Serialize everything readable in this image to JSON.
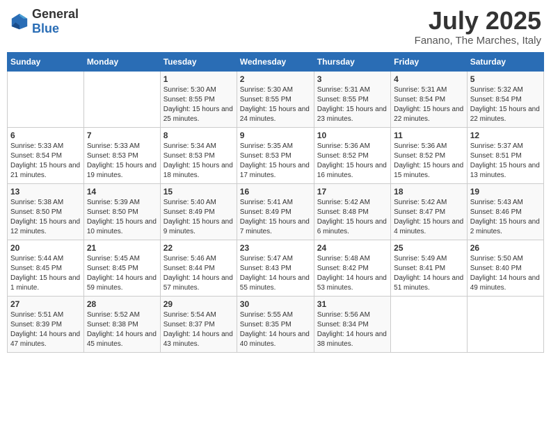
{
  "header": {
    "logo_general": "General",
    "logo_blue": "Blue",
    "month_title": "July 2025",
    "subtitle": "Fanano, The Marches, Italy"
  },
  "weekdays": [
    "Sunday",
    "Monday",
    "Tuesday",
    "Wednesday",
    "Thursday",
    "Friday",
    "Saturday"
  ],
  "weeks": [
    [
      {
        "day": "",
        "info": ""
      },
      {
        "day": "",
        "info": ""
      },
      {
        "day": "1",
        "info": "Sunrise: 5:30 AM\nSunset: 8:55 PM\nDaylight: 15 hours and 25 minutes."
      },
      {
        "day": "2",
        "info": "Sunrise: 5:30 AM\nSunset: 8:55 PM\nDaylight: 15 hours and 24 minutes."
      },
      {
        "day": "3",
        "info": "Sunrise: 5:31 AM\nSunset: 8:55 PM\nDaylight: 15 hours and 23 minutes."
      },
      {
        "day": "4",
        "info": "Sunrise: 5:31 AM\nSunset: 8:54 PM\nDaylight: 15 hours and 22 minutes."
      },
      {
        "day": "5",
        "info": "Sunrise: 5:32 AM\nSunset: 8:54 PM\nDaylight: 15 hours and 22 minutes."
      }
    ],
    [
      {
        "day": "6",
        "info": "Sunrise: 5:33 AM\nSunset: 8:54 PM\nDaylight: 15 hours and 21 minutes."
      },
      {
        "day": "7",
        "info": "Sunrise: 5:33 AM\nSunset: 8:53 PM\nDaylight: 15 hours and 19 minutes."
      },
      {
        "day": "8",
        "info": "Sunrise: 5:34 AM\nSunset: 8:53 PM\nDaylight: 15 hours and 18 minutes."
      },
      {
        "day": "9",
        "info": "Sunrise: 5:35 AM\nSunset: 8:53 PM\nDaylight: 15 hours and 17 minutes."
      },
      {
        "day": "10",
        "info": "Sunrise: 5:36 AM\nSunset: 8:52 PM\nDaylight: 15 hours and 16 minutes."
      },
      {
        "day": "11",
        "info": "Sunrise: 5:36 AM\nSunset: 8:52 PM\nDaylight: 15 hours and 15 minutes."
      },
      {
        "day": "12",
        "info": "Sunrise: 5:37 AM\nSunset: 8:51 PM\nDaylight: 15 hours and 13 minutes."
      }
    ],
    [
      {
        "day": "13",
        "info": "Sunrise: 5:38 AM\nSunset: 8:50 PM\nDaylight: 15 hours and 12 minutes."
      },
      {
        "day": "14",
        "info": "Sunrise: 5:39 AM\nSunset: 8:50 PM\nDaylight: 15 hours and 10 minutes."
      },
      {
        "day": "15",
        "info": "Sunrise: 5:40 AM\nSunset: 8:49 PM\nDaylight: 15 hours and 9 minutes."
      },
      {
        "day": "16",
        "info": "Sunrise: 5:41 AM\nSunset: 8:49 PM\nDaylight: 15 hours and 7 minutes."
      },
      {
        "day": "17",
        "info": "Sunrise: 5:42 AM\nSunset: 8:48 PM\nDaylight: 15 hours and 6 minutes."
      },
      {
        "day": "18",
        "info": "Sunrise: 5:42 AM\nSunset: 8:47 PM\nDaylight: 15 hours and 4 minutes."
      },
      {
        "day": "19",
        "info": "Sunrise: 5:43 AM\nSunset: 8:46 PM\nDaylight: 15 hours and 2 minutes."
      }
    ],
    [
      {
        "day": "20",
        "info": "Sunrise: 5:44 AM\nSunset: 8:45 PM\nDaylight: 15 hours and 1 minute."
      },
      {
        "day": "21",
        "info": "Sunrise: 5:45 AM\nSunset: 8:45 PM\nDaylight: 14 hours and 59 minutes."
      },
      {
        "day": "22",
        "info": "Sunrise: 5:46 AM\nSunset: 8:44 PM\nDaylight: 14 hours and 57 minutes."
      },
      {
        "day": "23",
        "info": "Sunrise: 5:47 AM\nSunset: 8:43 PM\nDaylight: 14 hours and 55 minutes."
      },
      {
        "day": "24",
        "info": "Sunrise: 5:48 AM\nSunset: 8:42 PM\nDaylight: 14 hours and 53 minutes."
      },
      {
        "day": "25",
        "info": "Sunrise: 5:49 AM\nSunset: 8:41 PM\nDaylight: 14 hours and 51 minutes."
      },
      {
        "day": "26",
        "info": "Sunrise: 5:50 AM\nSunset: 8:40 PM\nDaylight: 14 hours and 49 minutes."
      }
    ],
    [
      {
        "day": "27",
        "info": "Sunrise: 5:51 AM\nSunset: 8:39 PM\nDaylight: 14 hours and 47 minutes."
      },
      {
        "day": "28",
        "info": "Sunrise: 5:52 AM\nSunset: 8:38 PM\nDaylight: 14 hours and 45 minutes."
      },
      {
        "day": "29",
        "info": "Sunrise: 5:54 AM\nSunset: 8:37 PM\nDaylight: 14 hours and 43 minutes."
      },
      {
        "day": "30",
        "info": "Sunrise: 5:55 AM\nSunset: 8:35 PM\nDaylight: 14 hours and 40 minutes."
      },
      {
        "day": "31",
        "info": "Sunrise: 5:56 AM\nSunset: 8:34 PM\nDaylight: 14 hours and 38 minutes."
      },
      {
        "day": "",
        "info": ""
      },
      {
        "day": "",
        "info": ""
      }
    ]
  ]
}
